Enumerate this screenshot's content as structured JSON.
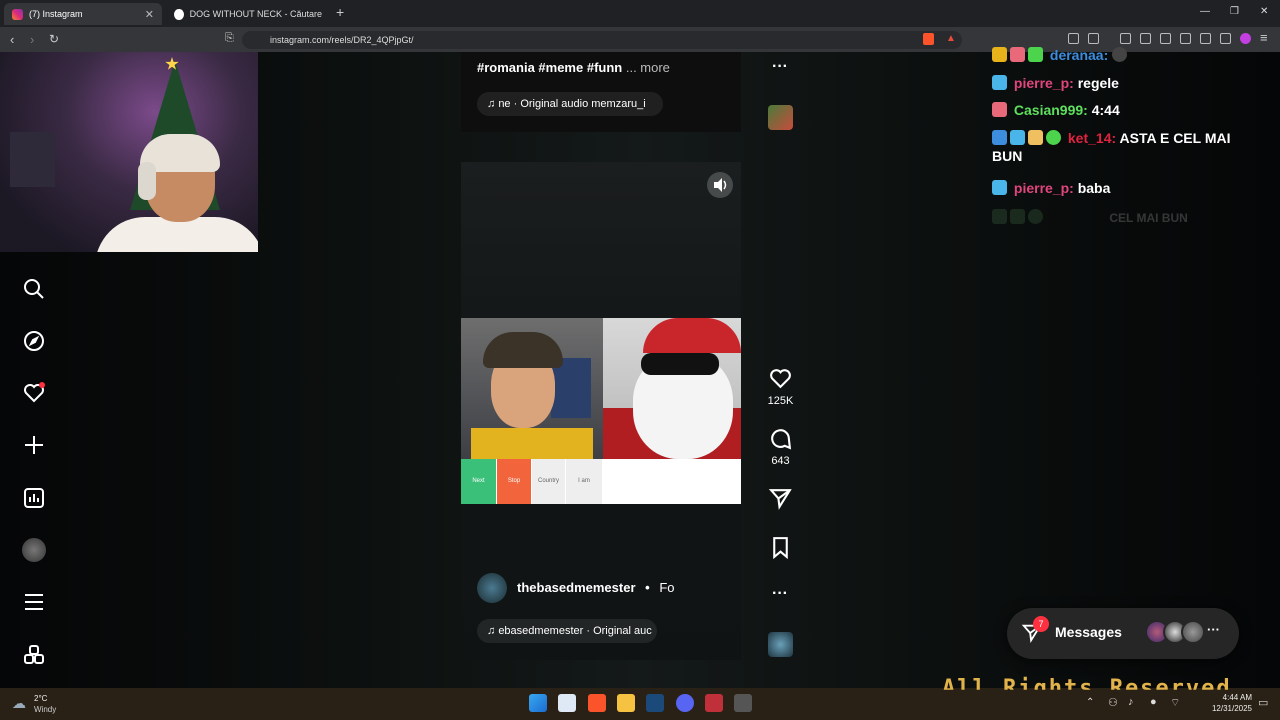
{
  "browser": {
    "tabs": [
      {
        "label": "(7) Instagram",
        "active": true
      },
      {
        "label": "DOG WITHOUT NECK - Căutare Goo",
        "active": false
      }
    ],
    "url": "instagram.com/reels/DR2_4QPjpGt/"
  },
  "reel_top": {
    "caption": "#romania #meme #funn",
    "more_label": "... more",
    "audio": "ne · Original audio  memzaru_i"
  },
  "reel_main": {
    "username": "thebasedmemester",
    "follow_label": "Fo",
    "audio": "ebasedmemester · Original auc",
    "video_buttons": [
      "Next",
      "Stop",
      "Country",
      "I am"
    ],
    "likes": "125K",
    "comments": "643"
  },
  "chat": [
    {
      "user": "deranaa:",
      "message": "",
      "user_color": "#3c8dde"
    },
    {
      "user": "pierre_p:",
      "message": "regele",
      "user_color": "#e0457b"
    },
    {
      "user": "Casian999:",
      "message": "4:44",
      "user_color": "#5ee05e"
    },
    {
      "user": "ket_14:",
      "message": "ASTA E CEL MAI BUN",
      "user_color": "#e0233f"
    },
    {
      "user": "pierre_p:",
      "message": "baba",
      "user_color": "#e0457b"
    },
    {
      "user": "",
      "message": "CEL MAI BUN",
      "user_color": "#444444"
    }
  ],
  "messages": {
    "label": "Messages",
    "badge": "7"
  },
  "taskbar": {
    "weather_temp": "2°C",
    "weather_desc": "Windy",
    "time": "4:44 AM",
    "date": "12/31/2025",
    "overlay_text": "All Rights Reserved"
  }
}
